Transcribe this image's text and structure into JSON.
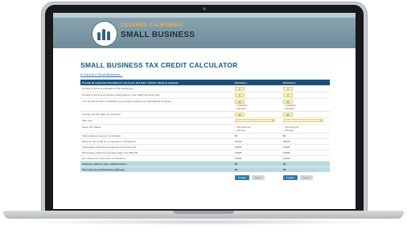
{
  "header": {
    "brand_top": "COVERED CALIFORNIA",
    "brand_bottom": "SMALL BUSINESS"
  },
  "page": {
    "title": "SMALL BUSINESS TAX CREDIT CALCULATOR",
    "breadcrumb": "If You Are A Small Business..."
  },
  "table": {
    "header": {
      "label": "Provide all requested information in the boxes and then \"submit\" below to calculate",
      "scenario_1": "Scenario 1",
      "scenario_2": "Scenario 2"
    },
    "rows": [
      {
        "label": "Number of full time equivalent (FTE) employees",
        "s1": "0",
        "s2": "0"
      },
      {
        "label": "Number of full time employees participating in your health insurance plan",
        "s1": "0",
        "s2": "0"
      },
      {
        "label": "Your annual premium contribution per a single employee per participating employee",
        "s1": "50",
        "s2": "50"
      },
      {
        "label": "Average annual wage per employee",
        "s1": "60",
        "s2": "60"
      },
      {
        "label": "Plan Year",
        "s1": "",
        "s2": ""
      },
      {
        "label": "Select Tax Status",
        "s1": "",
        "s2": ""
      }
    ],
    "premium_options": [
      "Individual",
      "Families"
    ],
    "tax_options": [
      "Non-Exempt",
      "Exempt"
    ],
    "results": [
      {
        "label": "Total employer premium contribution",
        "s1": "$0",
        "s2": "$0"
      },
      {
        "label": "Maximum tax credit up to employers' contributions",
        "s1": "0.00%",
        "s2": "0.00%"
      },
      {
        "label": "Percentage reduced by employees (count over 10)",
        "s1": "0.00%",
        "s2": "0.00%"
      },
      {
        "label": "Percentage reduced by average wage over $25,000",
        "s1": "0.00%",
        "s2": "0.00%"
      },
      {
        "label": "Tax credit as % of premium contributions",
        "s1": "0.00%",
        "s2": "0.00%"
      }
    ],
    "totals": [
      {
        "label": "Total tax credit for your small business",
        "s1": "$0",
        "s2": "$0"
      },
      {
        "label": "Tax credit per participating employee",
        "s1": "$0",
        "s2": "$0"
      }
    ],
    "buttons": {
      "primary": "Update",
      "secondary": "Reset"
    }
  }
}
